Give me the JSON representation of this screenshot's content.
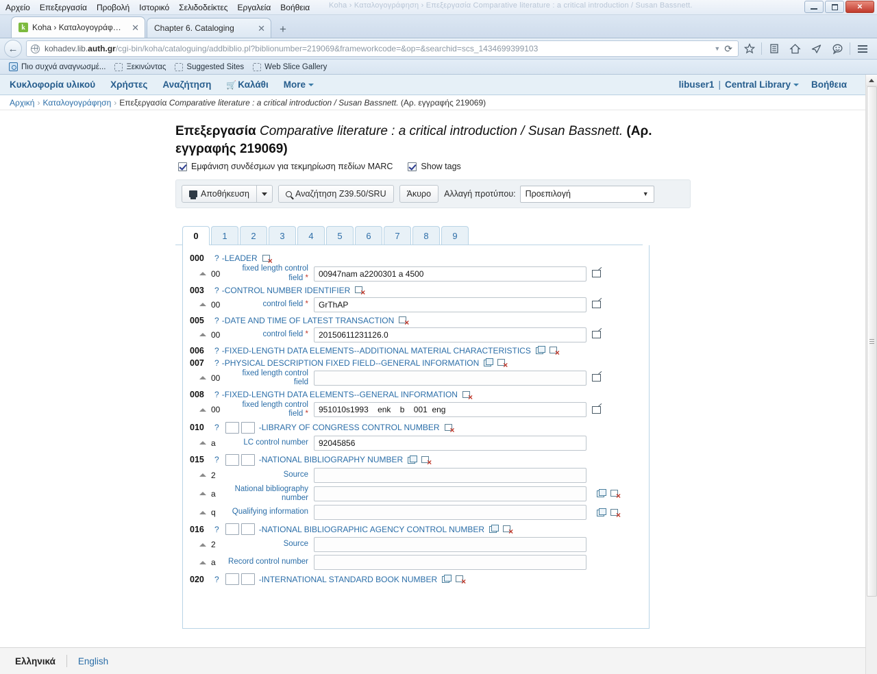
{
  "window": {
    "ghost_title": "Koha › Καταλογογράφηση › Επεξεργασία Comparative literature : a critical introduction / Susan Bassnett.",
    "minimize_label": "Ελαχιστοποίηση",
    "maximize_label": "Μεγιστοποίηση",
    "close_label": "✕"
  },
  "menubar": [
    {
      "label": "Αρχείο"
    },
    {
      "label": "Επεξεργασία"
    },
    {
      "label": "Προβολή"
    },
    {
      "label": "Ιστορικό"
    },
    {
      "label": "Σελιδοδείκτες"
    },
    {
      "label": "Εργαλεία"
    },
    {
      "label": "Βοήθεια"
    }
  ],
  "browser_tabs": [
    {
      "favicon": "k",
      "label": "Koha › Καταλογογράφηση ...",
      "close": "✕",
      "active": true
    },
    {
      "favicon": "",
      "label": "Chapter 6. Cataloging",
      "close": "✕",
      "active": false
    }
  ],
  "new_tab_label": "+",
  "urlbar": {
    "back_glyph": "←",
    "protocol_prefix": "kohadev.lib.",
    "host_bold": "auth.gr",
    "path": "/cgi-bin/koha/cataloguing/addbiblio.pl?biblionumber=219069&frameworkcode=&op=&searchid=scs_1434699399103",
    "dropdown_glyph": "▼",
    "reload_glyph": "⟳",
    "icons": [
      "star-icon",
      "reader-icon",
      "home-icon",
      "send-icon",
      "chat-icon",
      "menu-icon"
    ]
  },
  "bookmarks": [
    {
      "label": "Πιο συχνά αναγνωσμέ...",
      "icon": "bookmark-folder-icon"
    },
    {
      "label": "Ξεκινώντας",
      "icon": "dashed-box-icon"
    },
    {
      "label": "Suggested Sites",
      "icon": "dashed-box-icon"
    },
    {
      "label": "Web Slice Gallery",
      "icon": "dashed-box-icon"
    }
  ],
  "koha_nav": {
    "left": [
      {
        "label": "Κυκλοφορία υλικού"
      },
      {
        "label": "Χρήστες"
      },
      {
        "label": "Αναζήτηση"
      },
      {
        "label": "Καλάθι",
        "icon": "cart-icon"
      },
      {
        "label": "More",
        "caret": true
      }
    ],
    "user": "libuser1",
    "separator": "|",
    "library": "Central Library",
    "help": "Βοήθεια"
  },
  "breadcrumb": {
    "home": "Αρχική",
    "section": "Καταλογογράφηση",
    "action": "Επεξεργασία",
    "title_italic": "Comparative literature : a critical introduction / Susan Bassnett.",
    "record_suffix": "(Αρ. εγγραφής 219069)",
    "sep": "›"
  },
  "heading": {
    "prefix": "Επεξεργασία",
    "title_italic": "Comparative literature : a critical introduction / Susan Bassnett.",
    "record_no": "(Αρ. εγγραφής 219069)"
  },
  "checkboxes": [
    {
      "label": "Εμφάνιση συνδέσμων για τεκμηρίωση πεδίων MARC",
      "checked": true
    },
    {
      "label": "Show tags",
      "checked": true
    }
  ],
  "toolbar": {
    "save_label": "Αποθήκευση",
    "save_caret": "▾",
    "z3950_label": "Αναζήτηση Z39.50/SRU",
    "cancel_label": "Άκυρο",
    "framework_label": "Αλλαγή προτύπου:",
    "framework_value": "Προεπιλογή",
    "framework_caret": "▼"
  },
  "marc_tabs": [
    {
      "label": "0",
      "active": true
    },
    {
      "label": "1",
      "active": false
    },
    {
      "label": "2",
      "active": false
    },
    {
      "label": "3",
      "active": false
    },
    {
      "label": "4",
      "active": false
    },
    {
      "label": "5",
      "active": false
    },
    {
      "label": "6",
      "active": false
    },
    {
      "label": "7",
      "active": false
    },
    {
      "label": "8",
      "active": false
    },
    {
      "label": "9",
      "active": false
    }
  ],
  "marc_fields": [
    {
      "tag": "000",
      "help": "?",
      "dash": "-",
      "description": "LEADER",
      "indicators": false,
      "clone": false,
      "delete": true,
      "subfields": [
        {
          "code": "00",
          "label": "fixed length control field",
          "required": true,
          "value": "00947nam a2200301 a 4500",
          "edit": true,
          "clone": false,
          "delete": false
        }
      ]
    },
    {
      "tag": "003",
      "help": "?",
      "dash": "-",
      "description": "CONTROL NUMBER IDENTIFIER",
      "indicators": false,
      "clone": false,
      "delete": true,
      "subfields": [
        {
          "code": "00",
          "label": "control field",
          "required": true,
          "value": "GrThAP",
          "edit": true,
          "clone": false,
          "delete": false
        }
      ]
    },
    {
      "tag": "005",
      "help": "?",
      "dash": "-",
      "description": "DATE AND TIME OF LATEST TRANSACTION",
      "indicators": false,
      "clone": false,
      "delete": true,
      "subfields": [
        {
          "code": "00",
          "label": "control field",
          "required": true,
          "value": "20150611231126.0",
          "edit": true,
          "clone": false,
          "delete": false
        }
      ]
    },
    {
      "tag": "006",
      "help": "?",
      "dash": "-",
      "description": "FIXED-LENGTH DATA ELEMENTS--ADDITIONAL MATERIAL CHARACTERISTICS",
      "indicators": false,
      "clone": true,
      "delete": true,
      "subfields": []
    },
    {
      "tag": "007",
      "help": "?",
      "dash": "-",
      "description": "PHYSICAL DESCRIPTION FIXED FIELD--GENERAL INFORMATION",
      "indicators": false,
      "clone": true,
      "delete": true,
      "subfields": [
        {
          "code": "00",
          "label": "fixed length control field",
          "required": false,
          "value": "",
          "edit": true,
          "clone": false,
          "delete": false
        }
      ]
    },
    {
      "tag": "008",
      "help": "?",
      "dash": "-",
      "description": "FIXED-LENGTH DATA ELEMENTS--GENERAL INFORMATION",
      "indicators": false,
      "clone": false,
      "delete": true,
      "subfields": [
        {
          "code": "00",
          "label": "fixed length control field",
          "required": true,
          "value": "951010s1993    enk    b    001  eng",
          "edit": true,
          "clone": false,
          "delete": false
        }
      ]
    },
    {
      "tag": "010",
      "help": "?",
      "dash": "-",
      "description": "LIBRARY OF CONGRESS CONTROL NUMBER",
      "indicators": true,
      "clone": false,
      "delete": true,
      "subfields": [
        {
          "code": "a",
          "label": "LC control number",
          "required": false,
          "value": "92045856",
          "edit": false,
          "clone": false,
          "delete": false
        }
      ]
    },
    {
      "tag": "015",
      "help": "?",
      "dash": "-",
      "description": "NATIONAL BIBLIOGRAPHY NUMBER",
      "indicators": true,
      "clone": true,
      "delete": true,
      "subfields": [
        {
          "code": "2",
          "label": "Source",
          "required": false,
          "value": "",
          "edit": false,
          "clone": false,
          "delete": false
        },
        {
          "code": "a",
          "label": "National bibliography number",
          "required": false,
          "value": "",
          "edit": false,
          "clone": true,
          "delete": true
        },
        {
          "code": "q",
          "label": "Qualifying information",
          "required": false,
          "value": "",
          "edit": false,
          "clone": true,
          "delete": true
        }
      ]
    },
    {
      "tag": "016",
      "help": "?",
      "dash": "-",
      "description": "NATIONAL BIBLIOGRAPHIC AGENCY CONTROL NUMBER",
      "indicators": true,
      "clone": true,
      "delete": true,
      "subfields": [
        {
          "code": "2",
          "label": "Source",
          "required": false,
          "value": "",
          "edit": false,
          "clone": false,
          "delete": false
        },
        {
          "code": "a",
          "label": "Record control number",
          "required": false,
          "value": "",
          "edit": false,
          "clone": false,
          "delete": false
        }
      ]
    },
    {
      "tag": "020",
      "help": "?",
      "dash": "-",
      "description": "INTERNATIONAL STANDARD BOOK NUMBER",
      "indicators": true,
      "clone": true,
      "delete": true,
      "subfields": []
    }
  ],
  "language_footer": {
    "current": "Ελληνικά",
    "other": "English"
  },
  "colors": {
    "link": "#2b6ea8",
    "nav_bg": "#e6f0f7",
    "required": "#c0392b",
    "favicon": "#7dba3f"
  }
}
